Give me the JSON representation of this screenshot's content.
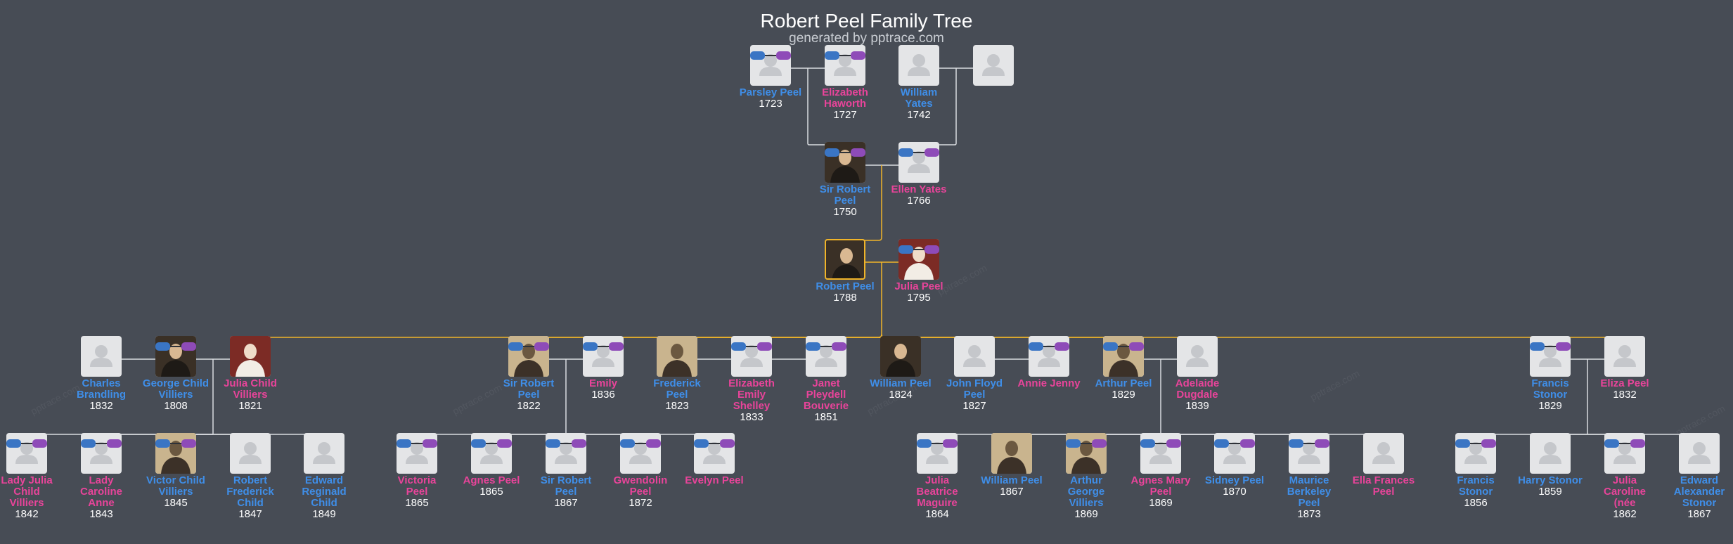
{
  "header": {
    "title": "Robert Peel Family Tree",
    "subtitle": "generated by pptrace.com"
  },
  "colors": {
    "background": "#474c55",
    "male_name": "#3f8ee8",
    "female_name": "#e8449a",
    "highlight_line": "#f0b429",
    "connector_line": "#d9dbe0"
  },
  "watermark": "pptrace.com",
  "people": [
    {
      "id": "parsley",
      "name": "Parsley Peel",
      "year": "1723",
      "gender": "m",
      "photo": "placeholder"
    },
    {
      "id": "elizabethH",
      "name": "Elizabeth Haworth",
      "year": "1727",
      "gender": "f",
      "photo": "placeholder"
    },
    {
      "id": "williamY",
      "name": "William Yates",
      "year": "1742",
      "gender": "m",
      "photo": "placeholder"
    },
    {
      "id": "unknownY",
      "name": "",
      "year": "",
      "gender": "f",
      "photo": "placeholder"
    },
    {
      "id": "sirRobert1750",
      "name": "Sir Robert Peel",
      "year": "1750",
      "gender": "m",
      "photo": "portrait"
    },
    {
      "id": "ellen",
      "name": "Ellen Yates",
      "year": "1766",
      "gender": "f",
      "photo": "placeholder"
    },
    {
      "id": "robert",
      "name": "Robert Peel",
      "year": "1788",
      "gender": "m",
      "photo": "portrait",
      "highlight": true
    },
    {
      "id": "julia",
      "name": "Julia Peel",
      "year": "1795",
      "gender": "f",
      "photo": "portrait-red"
    },
    {
      "id": "charles",
      "name": "Charles Brandling",
      "year": "1832",
      "gender": "m",
      "photo": "placeholder"
    },
    {
      "id": "george",
      "name": "George Child Villiers",
      "year": "1808",
      "gender": "m",
      "photo": "portrait"
    },
    {
      "id": "juliaCV",
      "name": "Julia Child Villiers",
      "year": "1821",
      "gender": "f",
      "photo": "portrait-red"
    },
    {
      "id": "sirRobert1822",
      "name": "Sir Robert Peel",
      "year": "1822",
      "gender": "m",
      "photo": "portrait-light"
    },
    {
      "id": "emily",
      "name": "Emily",
      "year": "1836",
      "gender": "f",
      "photo": "placeholder"
    },
    {
      "id": "frederick",
      "name": "Frederick Peel",
      "year": "1823",
      "gender": "m",
      "photo": "portrait-light"
    },
    {
      "id": "elizabethES",
      "name": "Elizabeth Emily Shelley",
      "year": "1833",
      "gender": "f",
      "photo": "placeholder"
    },
    {
      "id": "janet",
      "name": "Janet Pleydell Bouverie",
      "year": "1851",
      "gender": "f",
      "photo": "placeholder"
    },
    {
      "id": "williamP1824",
      "name": "William Peel",
      "year": "1824",
      "gender": "m",
      "photo": "portrait"
    },
    {
      "id": "johnFloyd",
      "name": "John Floyd Peel",
      "year": "1827",
      "gender": "m",
      "photo": "placeholder"
    },
    {
      "id": "annie",
      "name": "Annie Jenny",
      "year": "",
      "gender": "f",
      "photo": "placeholder"
    },
    {
      "id": "arthur",
      "name": "Arthur Peel",
      "year": "1829",
      "gender": "m",
      "photo": "portrait-light"
    },
    {
      "id": "adelaide",
      "name": "Adelaide Dugdale",
      "year": "1839",
      "gender": "f",
      "photo": "placeholder"
    },
    {
      "id": "francisS1829",
      "name": "Francis Stonor",
      "year": "1829",
      "gender": "m",
      "photo": "placeholder"
    },
    {
      "id": "eliza",
      "name": "Eliza Peel",
      "year": "1832",
      "gender": "f",
      "photo": "placeholder"
    },
    {
      "id": "ladyJulia",
      "name": "Lady Julia Child Villiers",
      "year": "1842",
      "gender": "f",
      "photo": "placeholder"
    },
    {
      "id": "ladyCaroline",
      "name": "Lady Caroline Anne",
      "year": "1843",
      "gender": "f",
      "photo": "placeholder"
    },
    {
      "id": "victor",
      "name": "Victor Child Villiers",
      "year": "1845",
      "gender": "m",
      "photo": "portrait-light"
    },
    {
      "id": "robertFC",
      "name": "Robert Frederick Child",
      "year": "1847",
      "gender": "m",
      "photo": "placeholder"
    },
    {
      "id": "edwardRC",
      "name": "Edward Reginald Child",
      "year": "1849",
      "gender": "m",
      "photo": "placeholder"
    },
    {
      "id": "victoria",
      "name": "Victoria Peel",
      "year": "1865",
      "gender": "f",
      "photo": "placeholder"
    },
    {
      "id": "agnes1865",
      "name": "Agnes Peel",
      "year": "1865",
      "gender": "f",
      "photo": "placeholder"
    },
    {
      "id": "sirRobert1867",
      "name": "Sir Robert Peel",
      "year": "1867",
      "gender": "m",
      "photo": "placeholder"
    },
    {
      "id": "gwendolin",
      "name": "Gwendolin Peel",
      "year": "1872",
      "gender": "f",
      "photo": "placeholder"
    },
    {
      "id": "evelyn",
      "name": "Evelyn Peel",
      "year": "",
      "gender": "f",
      "photo": "placeholder"
    },
    {
      "id": "juliaBM",
      "name": "Julia Beatrice Maguire",
      "year": "1864",
      "gender": "f",
      "photo": "placeholder"
    },
    {
      "id": "williamP1867",
      "name": "William Peel",
      "year": "1867",
      "gender": "m",
      "photo": "portrait-light"
    },
    {
      "id": "arthurGV",
      "name": "Arthur George Villiers",
      "year": "1869",
      "gender": "m",
      "photo": "portrait-light"
    },
    {
      "id": "agnesMary",
      "name": "Agnes Mary Peel",
      "year": "1869",
      "gender": "f",
      "photo": "placeholder"
    },
    {
      "id": "sidney",
      "name": "Sidney Peel",
      "year": "1870",
      "gender": "m",
      "photo": "placeholder"
    },
    {
      "id": "maurice",
      "name": "Maurice Berkeley Peel",
      "year": "1873",
      "gender": "m",
      "photo": "placeholder"
    },
    {
      "id": "ella",
      "name": "Ella Frances Peel",
      "year": "",
      "gender": "f",
      "photo": "placeholder"
    },
    {
      "id": "francisS1856",
      "name": "Francis Stonor",
      "year": "1856",
      "gender": "m",
      "photo": "placeholder"
    },
    {
      "id": "harry",
      "name": "Harry Stonor",
      "year": "1859",
      "gender": "m",
      "photo": "placeholder"
    },
    {
      "id": "juliaCS",
      "name": "Julia Caroline (née",
      "year": "1862",
      "gender": "f",
      "photo": "placeholder"
    },
    {
      "id": "edwardAS",
      "name": "Edward Alexander Stonor",
      "year": "1867",
      "gender": "m",
      "photo": "placeholder"
    }
  ]
}
